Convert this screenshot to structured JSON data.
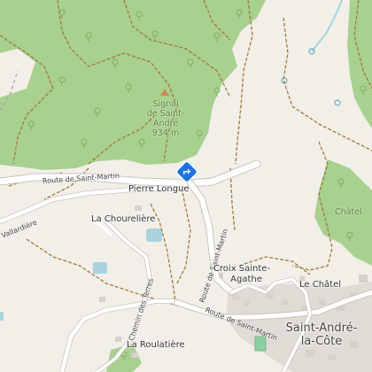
{
  "map": {
    "colors": {
      "background": "#f2efe9",
      "forest": "#a8d08f",
      "water": "#aad3df",
      "road": "#ffffff",
      "track": "#9e7a3a",
      "building": "#d9d0c9",
      "marker": "#1a73e8"
    },
    "icons": {
      "marker": "directions-diamond-icon",
      "peak": "peak-triangle-icon",
      "trees": "tree-symbol-icon"
    }
  },
  "labels": {
    "peak_name_1": "Signal",
    "peak_name_2": "de Saint-",
    "peak_name_3": "André",
    "peak_elevation": "934 m",
    "pierre_longue": "Pierre Longue",
    "chourelliere": "La Chourelière",
    "croix_1": "Croix Sainte-",
    "croix_2": "Agathe",
    "le_chatel": "Le Châtel",
    "chatel_forest": "Châtel",
    "saint_andre_1": "Saint-André-",
    "saint_andre_2": "la-Côte",
    "roulatiere": "La Roulatière"
  },
  "roads": {
    "route_sm_1": "Route de Saint-Martin",
    "route_sm_2": "Route de Saint-Martin",
    "route_sm_3": "Route de Saint-Martin",
    "chemin_terres": "Chemin des Terres",
    "vallardiere": "Vallardière"
  }
}
